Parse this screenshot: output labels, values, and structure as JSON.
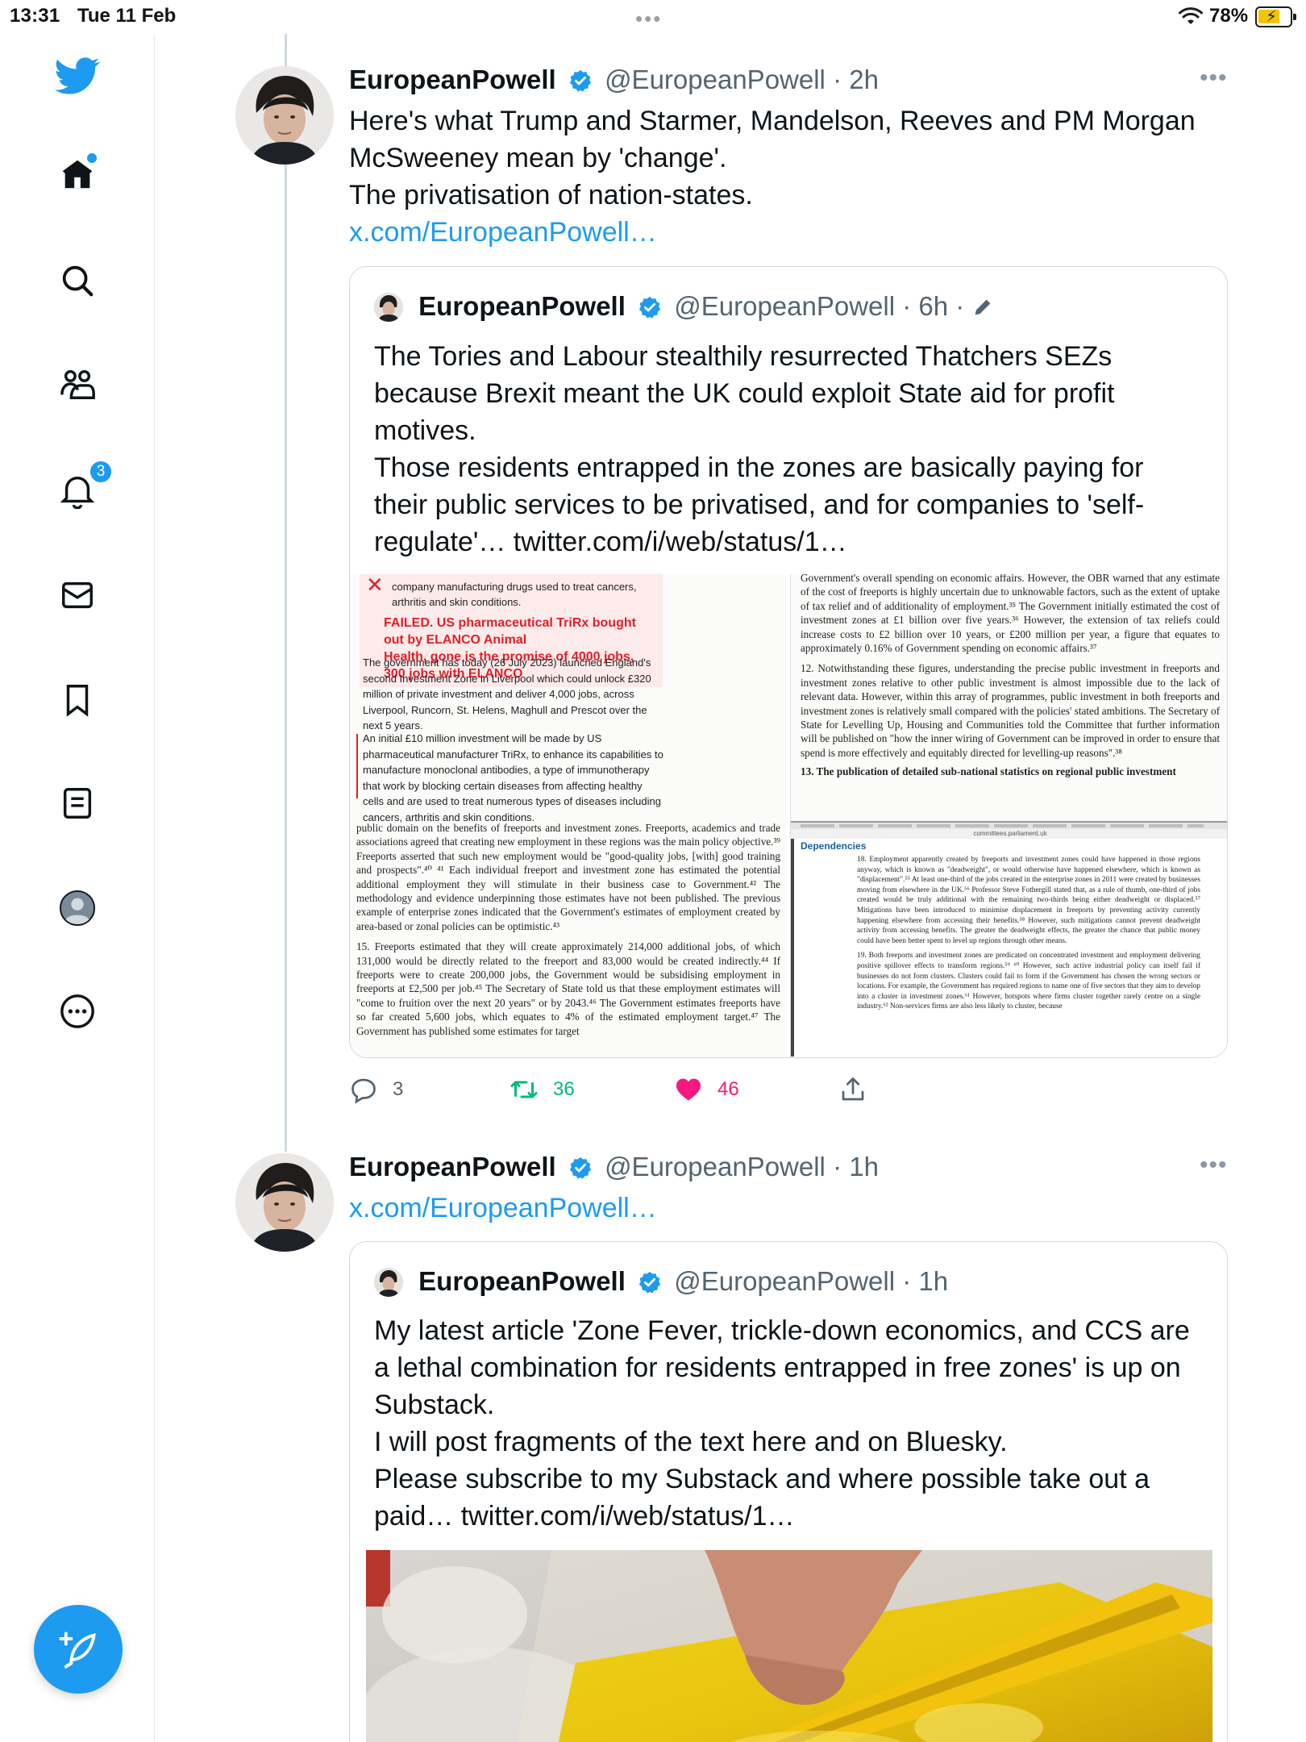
{
  "status_bar": {
    "time": "13:31",
    "date": "Tue 11 Feb",
    "battery": "78%"
  },
  "sidebar": {
    "items": [
      {
        "name": "home",
        "icon": "home-icon"
      },
      {
        "name": "search",
        "icon": "search-icon"
      },
      {
        "name": "communities",
        "icon": "communities-icon"
      },
      {
        "name": "notifications",
        "icon": "bell-icon",
        "badge": "3"
      },
      {
        "name": "messages",
        "icon": "mail-icon"
      },
      {
        "name": "bookmarks",
        "icon": "bookmark-icon"
      },
      {
        "name": "lists",
        "icon": "list-icon"
      },
      {
        "name": "profile",
        "icon": "profile-icon"
      },
      {
        "name": "more",
        "icon": "more-circle-icon"
      }
    ],
    "compose_icon": "compose-feather-icon"
  },
  "colors": {
    "accent": "#1d9bf0",
    "retweet": "#00ba7c",
    "like": "#f91880",
    "secondary_text": "#536471"
  },
  "tweets": [
    {
      "name": "EuropeanPowell",
      "handle": "@EuropeanPowell",
      "time": "2h",
      "lines": [
        "Here's what Trump and Starmer, Mandelson, Reeves and PM Morgan",
        "McSweeney mean by 'change'.",
        "The privatisation of nation-states."
      ],
      "link": "x.com/EuropeanPowell…",
      "quote": {
        "name": "EuropeanPowell",
        "handle": "@EuropeanPowell",
        "time": "6h",
        "lines": [
          "The Tories and Labour stealthily resurrected Thatchers SEZs",
          "because Brexit meant the UK could exploit State aid for profit",
          "motives.",
          "Those residents entrapped in the zones are basically paying for",
          "their public services to be privatised, and for companies to 'self-",
          "regulate'… twitter.com/i/web/status/1…"
        ],
        "doc_left": {
          "top_text": "company manufacturing drugs used to treat cancers, arthritis and skin conditions.",
          "red_line_1": "FAILED. US pharmaceutical TriRx bought out by ELANCO Animal",
          "red_line_2": "Health, gone is the promise of 4000 jobs, 300 jobs with ELANCO",
          "para_1": "The government has today (26 July 2023) launched England's second Investment Zone in Liverpool which could unlock £320 million of private investment and deliver 4,000 jobs, across Liverpool, Runcorn, St. Helens, Maghull and Prescot over the next 5 years.",
          "para_2": "An initial £10 million investment will be made by US pharmaceutical manufacturer TriRx, to enhance its capabilities to manufacture monoclonal antibodies, a type of immunotherapy that work by blocking certain diseases from affecting healthy cells and are used to treat numerous types of diseases including cancers, arthritis and skin conditions.",
          "para_3": "public domain on the benefits of freeports and investment zones. Freeports, academics and trade associations agreed that creating new employment in these regions was the main policy objective.³⁹ Freeports asserted that such new employment would be \"good-quality jobs, [with] good training and prospects\".⁴⁰ ⁴¹ Each individual freeport and investment zone has estimated the potential additional employment they will stimulate in their business case to Government.⁴² The methodology and evidence underpinning those estimates have not been published. The previous example of enterprise zones indicated that the Government's estimates of employment created by area-based or zonal policies can be optimistic.⁴³",
          "para_4": "15.  Freeports estimated that they will create approximately 214,000 additional jobs, of which 131,000 would be directly related to the freeport and 83,000 would be created indirectly.⁴⁴ If freeports were to create 200,000 jobs, the Government would be subsidising employment in freeports at £2,500 per job.⁴⁵ The Secretary of State told us that these employment estimates will \"come to fruition over the next 20 years\" or by 2043.⁴⁶ The Government estimates freeports have so far created 5,600 jobs, which equates to 4% of the estimated employment target.⁴⁷ The Government has published some estimates for target"
        },
        "doc_right": {
          "para_1": "Government's overall spending on economic affairs. However, the OBR warned that any estimate of the cost of freeports is highly uncertain due to unknowable factors, such as the extent of uptake of tax relief and of additionality of employment.³⁵ The Government initially estimated the cost of investment zones at £1 billion over five years.³⁶ However, the extension of tax reliefs could increase costs to £2 billion over 10 years, or £200 million per year, a figure that equates to approximately 0.16% of Government spending on economic affairs.³⁷",
          "para_2": "12.  Notwithstanding these figures, understanding the precise public investment in freeports and investment zones relative to other public investment is almost impossible due to the lack of relevant data. However, within this array of programmes, public investment in both freeports and investment zones is relatively small compared with the policies' stated ambitions. The Secretary of State for Levelling Up, Housing and Communities told the Committee that further information will be published on \"how the inner wiring of Government can be improved in order to ensure that spend is more effectively and equitably directed for levelling-up reasons\".³⁸",
          "heading_13": "13.  The publication of detailed sub-national statistics on regional public investment",
          "browser_url": "committees.parliament.uk",
          "dependencies": "Dependencies",
          "para_18": "18.  Employment apparently created by freeports and investment zones could have happened in those regions anyway, which is known as \"deadweight\", or would otherwise have happened elsewhere, which is known as \"displacement\".⁵⁵ At least one-third of the jobs created in the enterprise zones in 2011 were created by businesses moving from elsewhere in the UK.⁵⁶ Professor Steve Fothergill stated that, as a rule of thumb, one-third of jobs created would be truly additional with the remaining two-thirds being either deadweight or displaced.⁵⁷ Mitigations have been introduced to minimise displacement in freeports by preventing activity currently happening elsewhere from accessing their benefits.⁵⁸ However, such mitigations cannot prevent deadweight activity from accessing benefits. The greater the deadweight effects, the greater the chance that public money could have been better spent to level up regions through other means.",
          "para_19": "19.  Both freeports and investment zones are predicated on concentrated investment and employment delivering positive spillover effects to transform regions.⁵⁹ ⁶⁰ However, such active industrial policy can itself fail if businesses do not form clusters. Clusters could fail to form if the Government has chosen the wrong sectors or locations. For example, the Government has required regions to name one of five sectors that they aim to develop into a cluster in investment zones.⁶¹ However, hotspots where firms cluster together rarely centre on a single industry.⁶² Non-services firms are also less likely to cluster, because"
        }
      },
      "actions": {
        "replies": "3",
        "retweets": "36",
        "likes": "46"
      }
    },
    {
      "name": "EuropeanPowell",
      "handle": "@EuropeanPowell",
      "time": "1h",
      "link": "x.com/EuropeanPowell…",
      "quote": {
        "name": "EuropeanPowell",
        "handle": "@EuropeanPowell",
        "time": "1h",
        "lines": [
          "My latest article 'Zone Fever, trickle-down economics, and CCS are",
          "a lethal combination for residents entrapped in free zones' is up on",
          "Substack.",
          "I will post fragments of the text here and on Bluesky.",
          "Please subscribe to my Substack and where possible take out a",
          "paid… twitter.com/i/web/status/1…"
        ]
      }
    }
  ]
}
